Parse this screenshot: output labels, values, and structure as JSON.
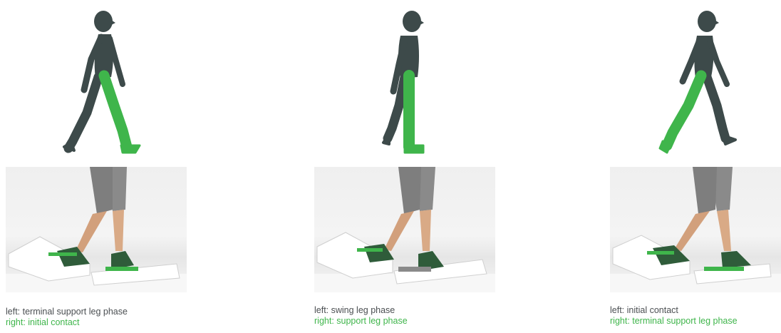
{
  "colors": {
    "figure_body": "#3d4a4a",
    "highlight_leg": "#3fb54b",
    "caption_text": "#4b4f52",
    "caption_accent": "#3fb54b"
  },
  "panels": [
    {
      "left_label": "left: terminal support leg phase",
      "right_label": "right: initial contact"
    },
    {
      "left_label": "left: swing leg phase",
      "right_label": "right: support leg phase"
    },
    {
      "left_label": "left: initial contact",
      "right_label": "right: terminal support leg phase"
    }
  ]
}
